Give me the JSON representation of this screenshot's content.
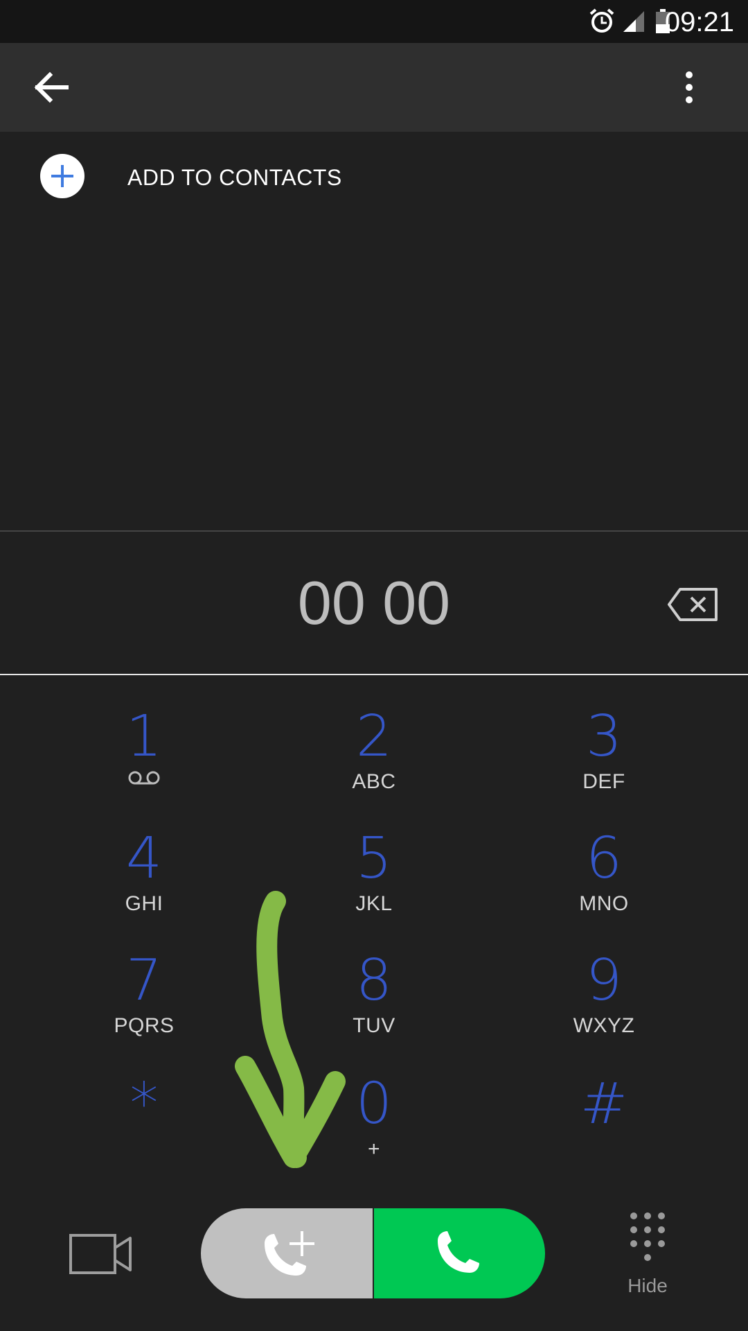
{
  "status_bar": {
    "time": "09:21",
    "icons": [
      "alarm-icon",
      "signal-icon",
      "battery-icon"
    ]
  },
  "app_bar": {
    "back_icon": "arrow-left-icon",
    "more_icon": "more-vert-icon"
  },
  "add_contact": {
    "label": "ADD TO CONTACTS",
    "icon": "plus-icon"
  },
  "dialer": {
    "number": "00 00",
    "backspace_icon": "backspace-icon"
  },
  "keypad": [
    {
      "digit": "1",
      "letters": ""
    },
    {
      "digit": "2",
      "letters": "ABC"
    },
    {
      "digit": "3",
      "letters": "DEF"
    },
    {
      "digit": "4",
      "letters": "GHI"
    },
    {
      "digit": "5",
      "letters": "JKL"
    },
    {
      "digit": "6",
      "letters": "MNO"
    },
    {
      "digit": "7",
      "letters": "PQRS"
    },
    {
      "digit": "8",
      "letters": "TUV"
    },
    {
      "digit": "9",
      "letters": "WXYZ"
    },
    {
      "digit": "*",
      "letters": ""
    },
    {
      "digit": "0",
      "letters": "+"
    },
    {
      "digit": "#",
      "letters": ""
    }
  ],
  "bottom_bar": {
    "video_icon": "video-call-icon",
    "add_call_icon": "add-call-icon",
    "call_icon": "call-icon",
    "hide_label": "Hide",
    "hide_icon": "dialpad-icon"
  },
  "colors": {
    "background": "#202020",
    "app_bar": "#2f2f2f",
    "digit": "#3556c8",
    "call_green": "#00c853",
    "add_call_grey": "#c0c0c0",
    "annotation": "#8bc34a"
  }
}
